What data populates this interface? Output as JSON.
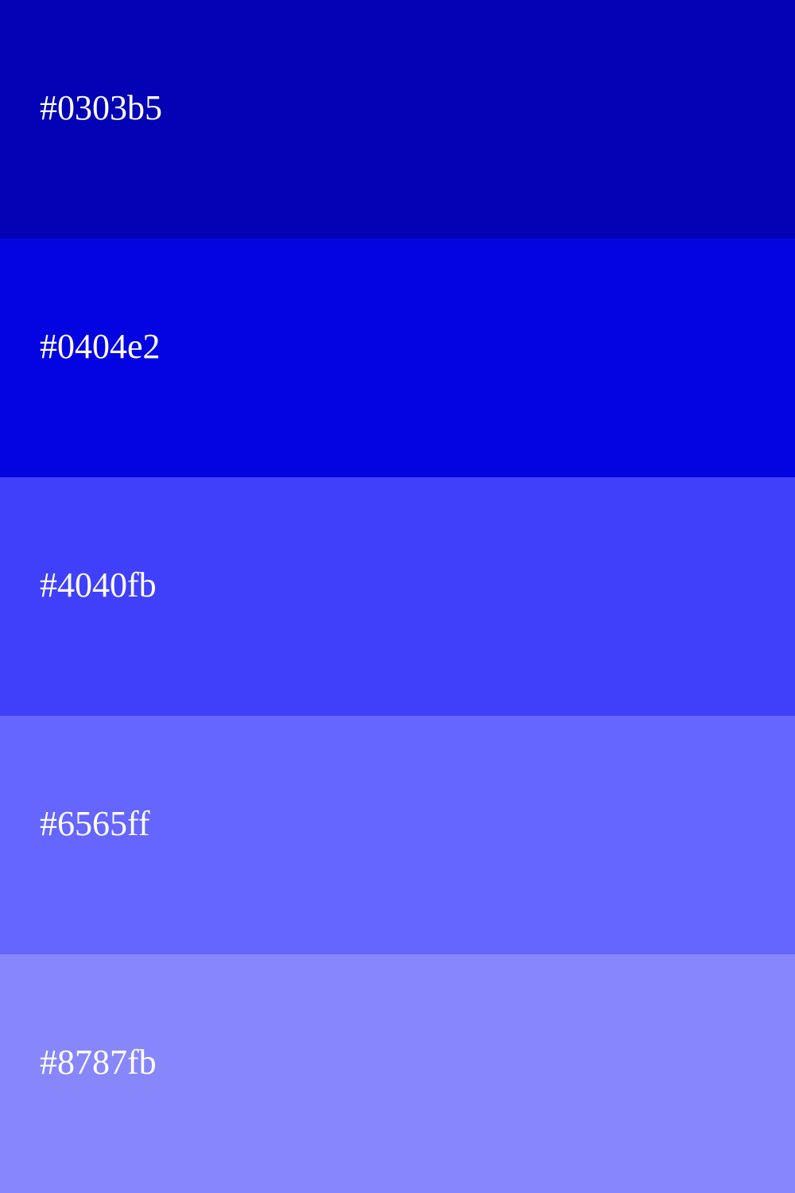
{
  "palette": {
    "swatches": [
      {
        "label": "#0303b5",
        "color": "#0303b5"
      },
      {
        "label": "#0404e2",
        "color": "#0404e2"
      },
      {
        "label": "#4040fb",
        "color": "#4040fb"
      },
      {
        "label": "#6565ff",
        "color": "#6565ff"
      },
      {
        "label": "#8787fb",
        "color": "#8787fb"
      }
    ],
    "label_color": "#ffffff"
  }
}
